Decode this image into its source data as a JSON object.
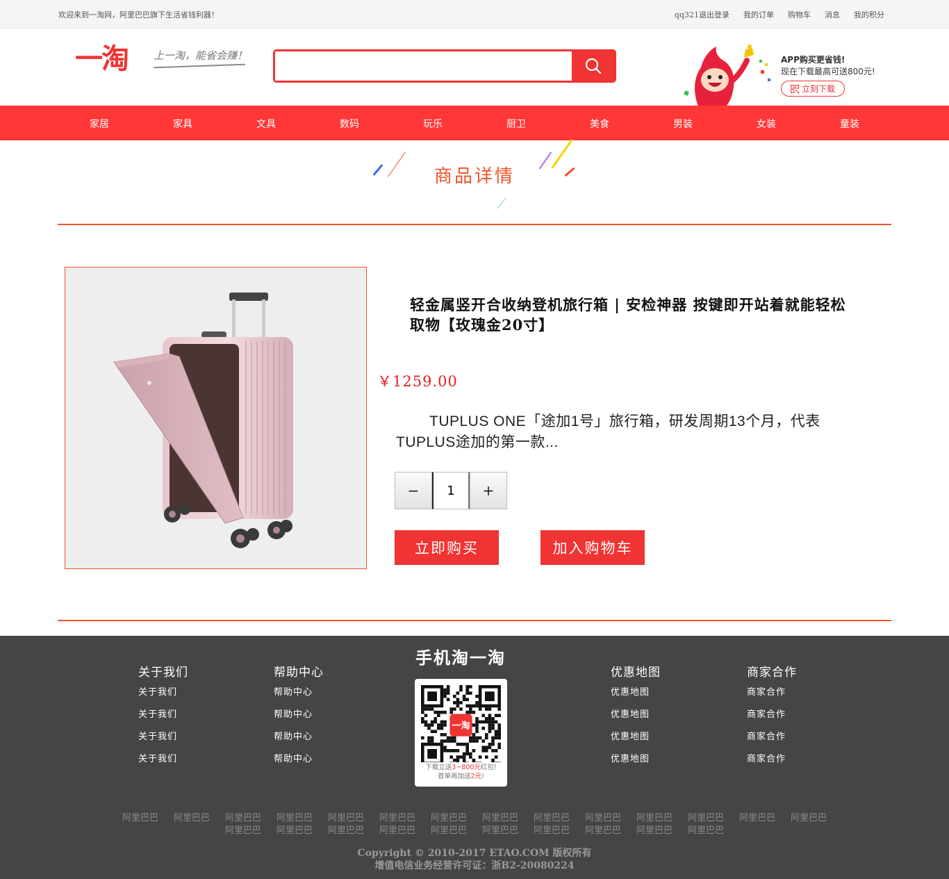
{
  "topbar": {
    "welcome": "欢迎来到一淘网，阿里巴巴旗下生活省钱利器！",
    "links": [
      "qq321退出登录",
      "我的订单",
      "购物车",
      "消息",
      "我的积分"
    ]
  },
  "header": {
    "logo_text": "一淘",
    "slogan": "上一淘，能省会赚！",
    "search": {
      "value": "",
      "placeholder": ""
    },
    "app_promo": {
      "title": "APP购买更省钱!",
      "subtitle": "现在下载最高可送800元!",
      "button": "立刻下载"
    }
  },
  "nav": [
    "家居",
    "家具",
    "文具",
    "数码",
    "玩乐",
    "厨卫",
    "美食",
    "男装",
    "女装",
    "童装"
  ],
  "section_title": "商品详情",
  "product": {
    "title": "轻金属竖开合收纳登机旅行箱 | 安检神器 按键即开站着就能轻松取物【玫瑰金20寸】",
    "price": "￥1259.00",
    "description": "TUPLUS ONE「途加1号」旅行箱，研发周期13个月，代表TUPLUS途加的第一款...",
    "quantity": "1",
    "minus_label": "−",
    "plus_label": "+",
    "buy_now": "立即购买",
    "add_to_cart": "加入购物车"
  },
  "footer": {
    "columns": [
      {
        "head": "关于我们",
        "links": [
          "关于我们",
          "关于我们",
          "关于我们",
          "关于我们"
        ]
      },
      {
        "head": "帮助中心",
        "links": [
          "帮助中心",
          "帮助中心",
          "帮助中心",
          "帮助中心"
        ]
      },
      {
        "head": "优惠地图",
        "links": [
          "优惠地图",
          "优惠地图",
          "优惠地图",
          "优惠地图"
        ]
      },
      {
        "head": "商家合作",
        "links": [
          "商家合作",
          "商家合作",
          "商家合作",
          "商家合作"
        ]
      }
    ],
    "mobile_title": "手机淘一淘",
    "qr_logo": "一淘",
    "qr_line1_a": "下载立送",
    "qr_line1_b": "3~800元",
    "qr_line1_c": "红包!",
    "qr_line2_a": "首单再加送",
    "qr_line2_b": "2元",
    "qr_line2_c": "!",
    "ali_row1": [
      "阿里巴巴",
      "阿里巴巴",
      "阿里巴巴",
      "阿里巴巴",
      "阿里巴巴",
      "阿里巴巴",
      "阿里巴巴",
      "阿里巴巴",
      "阿里巴巴",
      "阿里巴巴",
      "阿里巴巴",
      "阿里巴巴",
      "阿里巴巴",
      "阿里巴巴"
    ],
    "ali_row2": [
      "阿里巴巴",
      "阿里巴巴",
      "阿里巴巴",
      "阿里巴巴",
      "阿里巴巴",
      "阿里巴巴",
      "阿里巴巴",
      "阿里巴巴",
      "阿里巴巴",
      "阿里巴巴"
    ],
    "copyright": "Copyright © 2010-2017 ETAO.COM 版权所有",
    "license": "增值电信业务经营许可证：浙B2-20080224"
  },
  "colors": {
    "brand_red": "#ff3737",
    "accent_orange": "#f0522a",
    "footer_bg": "#454545"
  },
  "icons": [
    "search-icon",
    "qr-code-icon",
    "mascot-illustration",
    "suitcase-product-image"
  ]
}
